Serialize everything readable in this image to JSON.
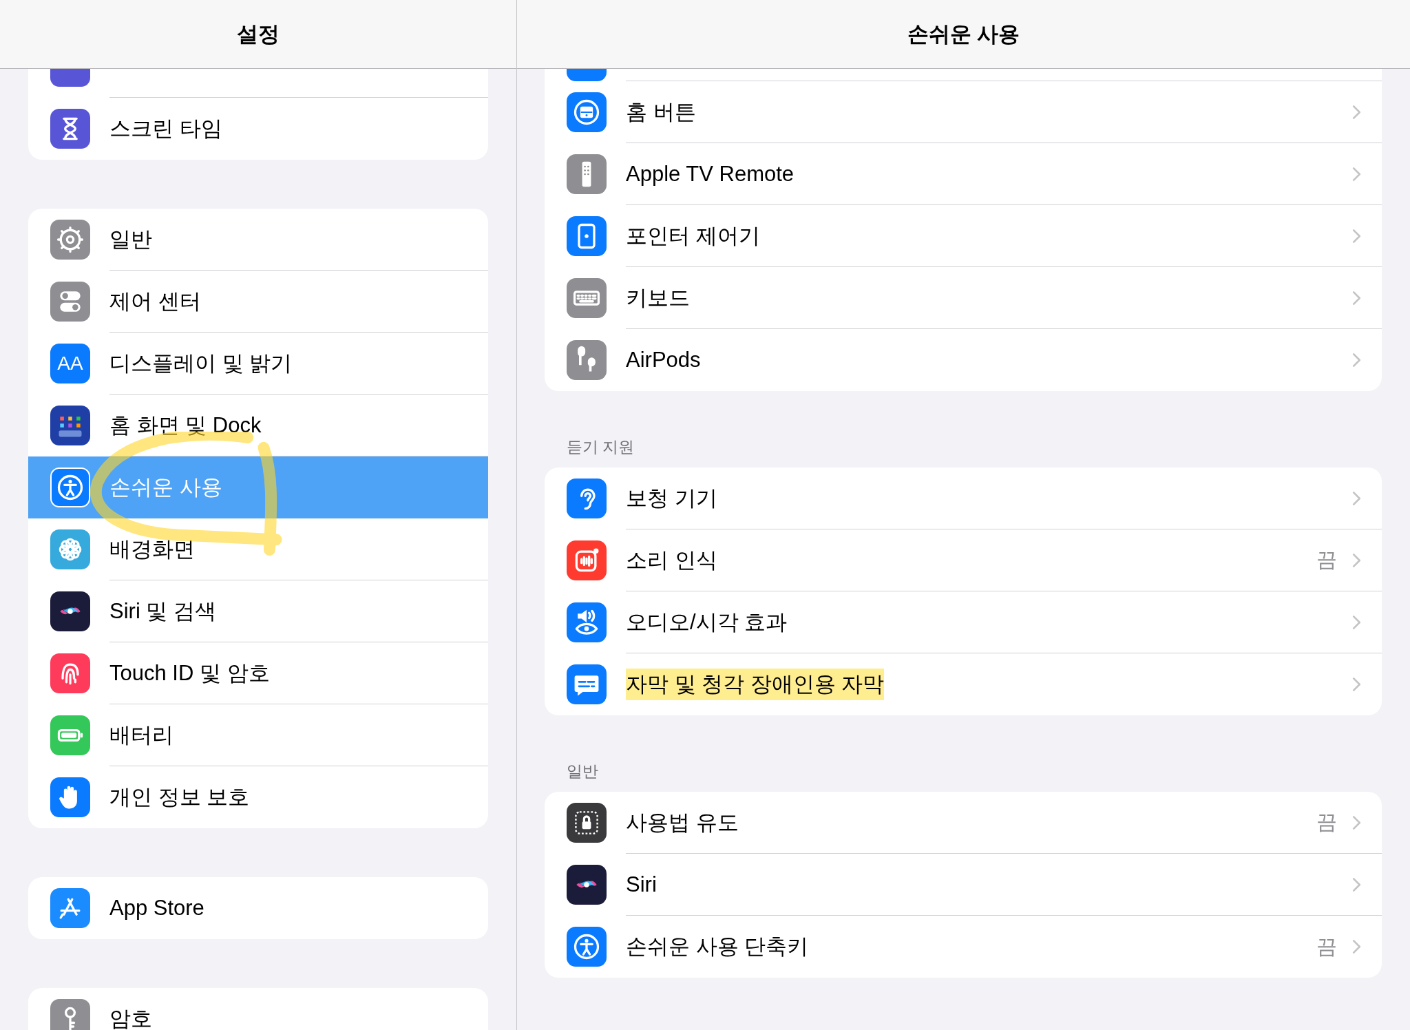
{
  "sidebar": {
    "title": "설정",
    "groups": [
      {
        "items": [
          {
            "label": "스크린 타임",
            "selected": false,
            "annotated": false
          }
        ]
      },
      {
        "items": [
          {
            "label": "일반",
            "selected": false,
            "annotated": false
          },
          {
            "label": "제어 센터",
            "selected": false,
            "annotated": false
          },
          {
            "label": "디스플레이 및 밝기",
            "selected": false,
            "annotated": false,
            "icon_text": "AA"
          },
          {
            "label": "홈 화면 및 Dock",
            "selected": false,
            "annotated": false
          },
          {
            "label": "손쉬운 사용",
            "selected": true,
            "annotated": true
          },
          {
            "label": "배경화면",
            "selected": false,
            "annotated": false
          },
          {
            "label": "Siri 및 검색",
            "selected": false,
            "annotated": false
          },
          {
            "label": "Touch ID 및 암호",
            "selected": false,
            "annotated": false
          },
          {
            "label": "배터리",
            "selected": false,
            "annotated": false
          },
          {
            "label": "개인 정보 보호",
            "selected": false,
            "annotated": false
          }
        ]
      },
      {
        "items": [
          {
            "label": "App Store",
            "selected": false,
            "annotated": false
          }
        ]
      },
      {
        "items": [
          {
            "label": "암호",
            "selected": false,
            "annotated": false
          }
        ]
      }
    ]
  },
  "detail": {
    "title": "손쉬운 사용",
    "sections": [
      {
        "items": [
          {
            "label": "홈 버튼",
            "highlighted": false
          },
          {
            "label": "Apple TV Remote",
            "highlighted": false
          },
          {
            "label": "포인터 제어기",
            "highlighted": false
          },
          {
            "label": "키보드",
            "highlighted": false
          },
          {
            "label": "AirPods",
            "highlighted": false
          }
        ]
      },
      {
        "header": "듣기 지원",
        "items": [
          {
            "label": "보청 기기",
            "highlighted": false
          },
          {
            "label": "소리 인식",
            "value": "끔",
            "highlighted": false
          },
          {
            "label": "오디오/시각 효과",
            "highlighted": false
          },
          {
            "label": "자막 및 청각 장애인용 자막",
            "highlighted": true
          }
        ]
      },
      {
        "header": "일반",
        "items": [
          {
            "label": "사용법 유도",
            "value": "끔",
            "highlighted": false
          },
          {
            "label": "Siri",
            "highlighted": false
          },
          {
            "label": "손쉬운 사용 단축키",
            "value": "끔",
            "highlighted": false
          }
        ]
      }
    ]
  }
}
